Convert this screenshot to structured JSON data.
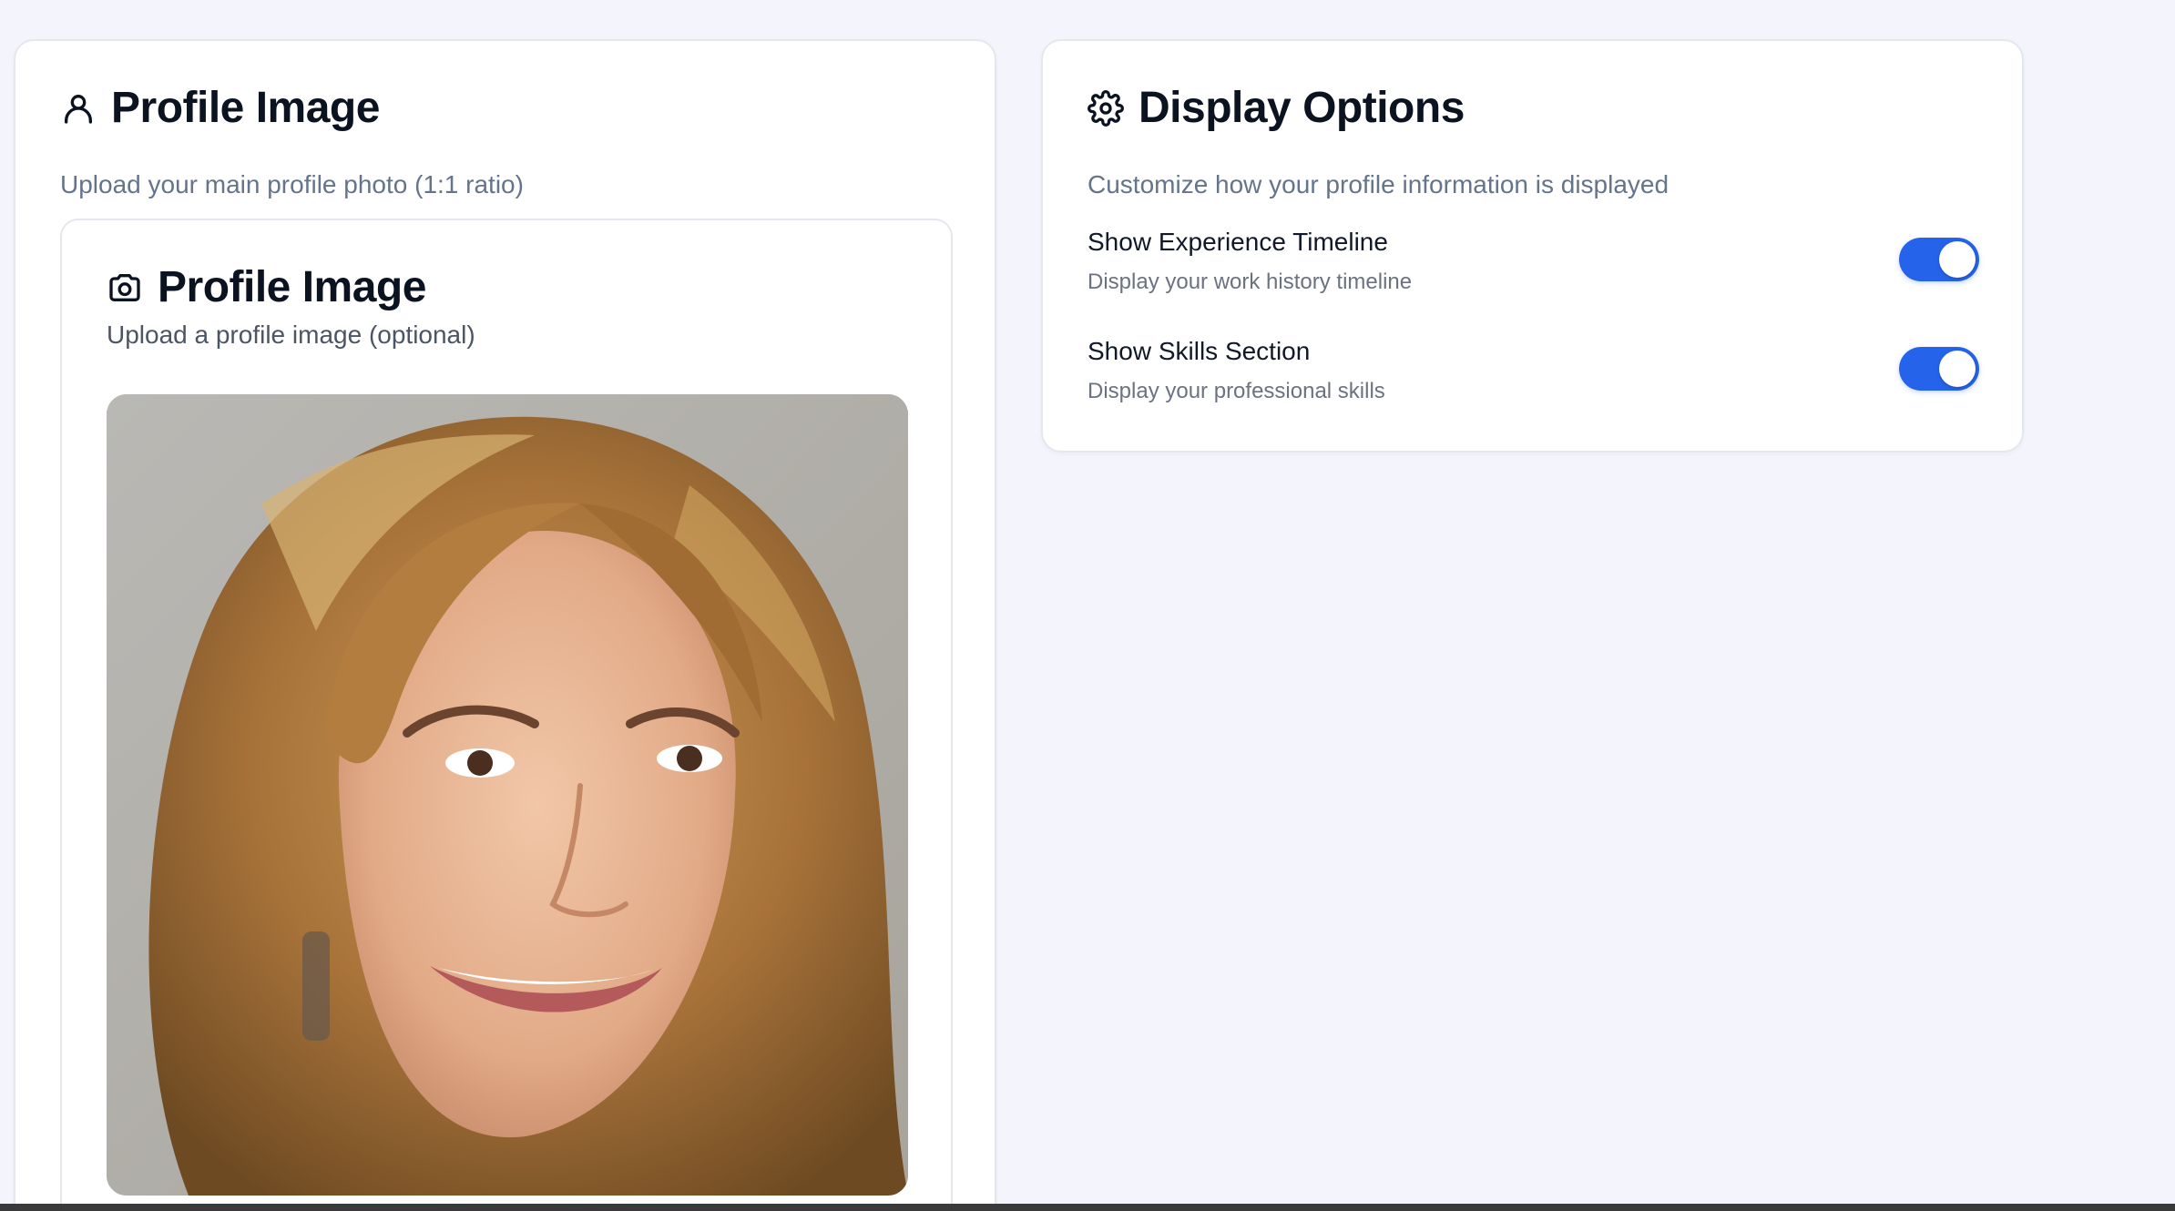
{
  "profile_card": {
    "title": "Profile Image",
    "subtitle": "Upload your main profile photo (1:1 ratio)",
    "icon": "user-icon",
    "uploader": {
      "title": "Profile Image",
      "subtitle": "Upload a profile image (optional)",
      "icon": "camera-icon"
    }
  },
  "display_card": {
    "title": "Display Options",
    "subtitle": "Customize how your profile information is displayed",
    "icon": "gear-icon",
    "options": [
      {
        "label": "Show Experience Timeline",
        "description": "Display your work history timeline",
        "enabled": true
      },
      {
        "label": "Show Skills Section",
        "description": "Display your professional skills",
        "enabled": true
      }
    ]
  },
  "colors": {
    "accent": "#2563eb",
    "page_bg": "#f4f5fc",
    "card_bg": "#ffffff"
  }
}
